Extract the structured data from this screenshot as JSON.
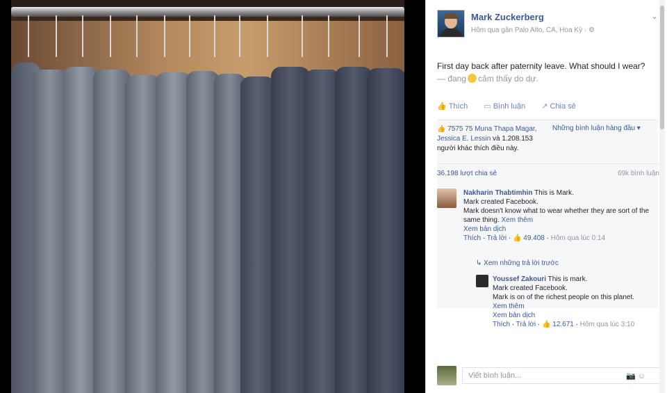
{
  "post": {
    "author": "Mark Zuckerberg",
    "meta": "Hôm qua gần Palo Alto, CA, Hoa Kỳ · ⚙",
    "text": "First day back after paternity leave. What should I wear?",
    "feeling_prefix": "— đang",
    "feeling_suffix": "cảm thấy do dự."
  },
  "actions": {
    "like": "Thích",
    "comment": "Bình luận",
    "share": "Chia sẻ"
  },
  "likes": {
    "text_start": "7575 75",
    "bold_names": "Muna Thapa Magar, Jessica E. Lessin",
    "text_mid": "và 1.208.153 người khác",
    "text_end": "thích điều này.",
    "sort_label": "Những bình luận hàng đầu ▾"
  },
  "shares": {
    "count": "36.198 lượt chia sẻ",
    "comments": "69k bình luận"
  },
  "comment1": {
    "name": "Nakharin Thabtimhin",
    "line1": "This is Mark.",
    "line2": "Mark created Facebook.",
    "line3": "Mark doesn't know what to wear whether they are sort of the same thing.",
    "more": "Xem thêm",
    "translate": "Xem bản dịch",
    "like": "Thích",
    "reply": "Trả lời",
    "likes": "49.408",
    "time": "Hôm qua lúc 0:14"
  },
  "view_replies": "Xem những trả lời trước",
  "comment2": {
    "name": "Youssef Zakouri",
    "line1": "This is mark.",
    "line2": "Mark created Facebook.",
    "line3": "Mark is on of the richest people on this planet.",
    "more": "Xem thêm",
    "translate": "Xem bản dịch",
    "like": "Thích",
    "reply": "Trả lời",
    "likes": "12.671",
    "time": "Hôm qua lúc 3:10"
  },
  "write": {
    "placeholder": "Viết bình luận...",
    "camera": "📷",
    "smile": "☺"
  }
}
